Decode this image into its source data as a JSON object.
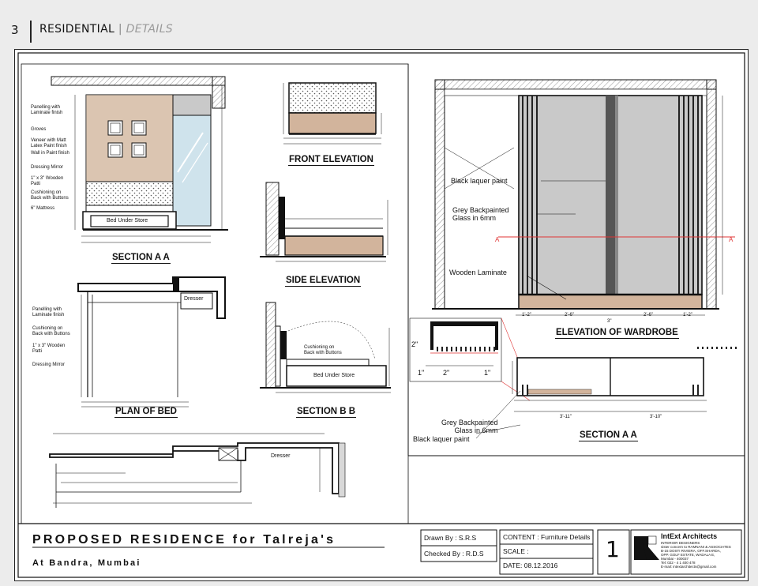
{
  "header": {
    "page_number": "3",
    "section": "RESIDENTIAL",
    "separator": "|",
    "subsection": "DETAILS"
  },
  "drawings": {
    "section_aa_bed": {
      "title": "SECTION A A",
      "labels": [
        "Panelling with\nLaminate finish",
        "Groves",
        "Veneer with Matt\nLatex Paint finish",
        "Wall in Paint finish",
        "Dressing Mirror",
        "1\" x 3\" Wooden\nPatti",
        "Cushioning on\nBack with Buttons",
        "6\" Mattress"
      ],
      "store_label": "Bed Under Store"
    },
    "front_elevation": {
      "title": "FRONT ELEVATION"
    },
    "side_elevation": {
      "title": "SIDE ELEVATION"
    },
    "plan_of_bed": {
      "title": "PLAN OF BED",
      "labels": [
        "Panelling with\nLaminate finish",
        "Cushioning on\nBack with Buttons",
        "1\" x 3\" Wooden\nPatti",
        "Dressing Mirror"
      ],
      "dresser": "Dresser"
    },
    "section_bb": {
      "title": "SECTION B B",
      "cushion": "Cushioning on\nBack with Buttons",
      "store_label": "Bed Under Store"
    },
    "long_plan": {
      "dresser": "Dresser"
    },
    "wardrobe": {
      "title": "ELEVATION OF WARDROBE",
      "labels": [
        "Black laquer paint",
        "Grey Backpainted\nGlass in 6mm",
        "Wooden Laminate"
      ],
      "dims": [
        "1'-2\"",
        "2'-6\"",
        "3\"",
        "2'-6\"",
        "1'-2\""
      ]
    },
    "section_aa_wardrobe": {
      "title": "SECTION A A",
      "detail_dims": [
        "2\"",
        "1\"",
        "2\"",
        "1\""
      ],
      "labels": [
        "Grey Backpainted\nGlass in 6mm",
        "Black laquer paint"
      ],
      "dims": [
        "3'-11\"",
        "3'-10\""
      ]
    }
  },
  "title_block": {
    "project_title": "PROPOSED RESIDENCE for Talreja's",
    "location": "At Bandra, Mumbai",
    "drawn_by": "Drawn By : S.R.S",
    "checked_by": "Checked By : R.D.S",
    "content": "CONTENT : Furniture Details",
    "scale": "SCALE :",
    "date": "DATE: 08.12.2016",
    "sheet_number": "1",
    "firm_name": "IntExt Architects",
    "firm_sub": "INTERIOR DESIGNERS\nsister concern to RAMNANI & ASSOCIATES\nB-15 DOSTI RIVIERA, OFF.SHARDA,\nOPP. GOLF ESTATE, WADALA E,\nMumbai - 400037\nTel: 022 - 4 1 400 478\nE-mail: intextarchitects@gmail.com"
  },
  "colors": {
    "wood": "#d2b49c",
    "wood_dark": "#b8957a",
    "glass": "#cfe3ec",
    "grey": "#c9c9c9",
    "red": "#e03535",
    "laquer": "#3a3a3a"
  }
}
